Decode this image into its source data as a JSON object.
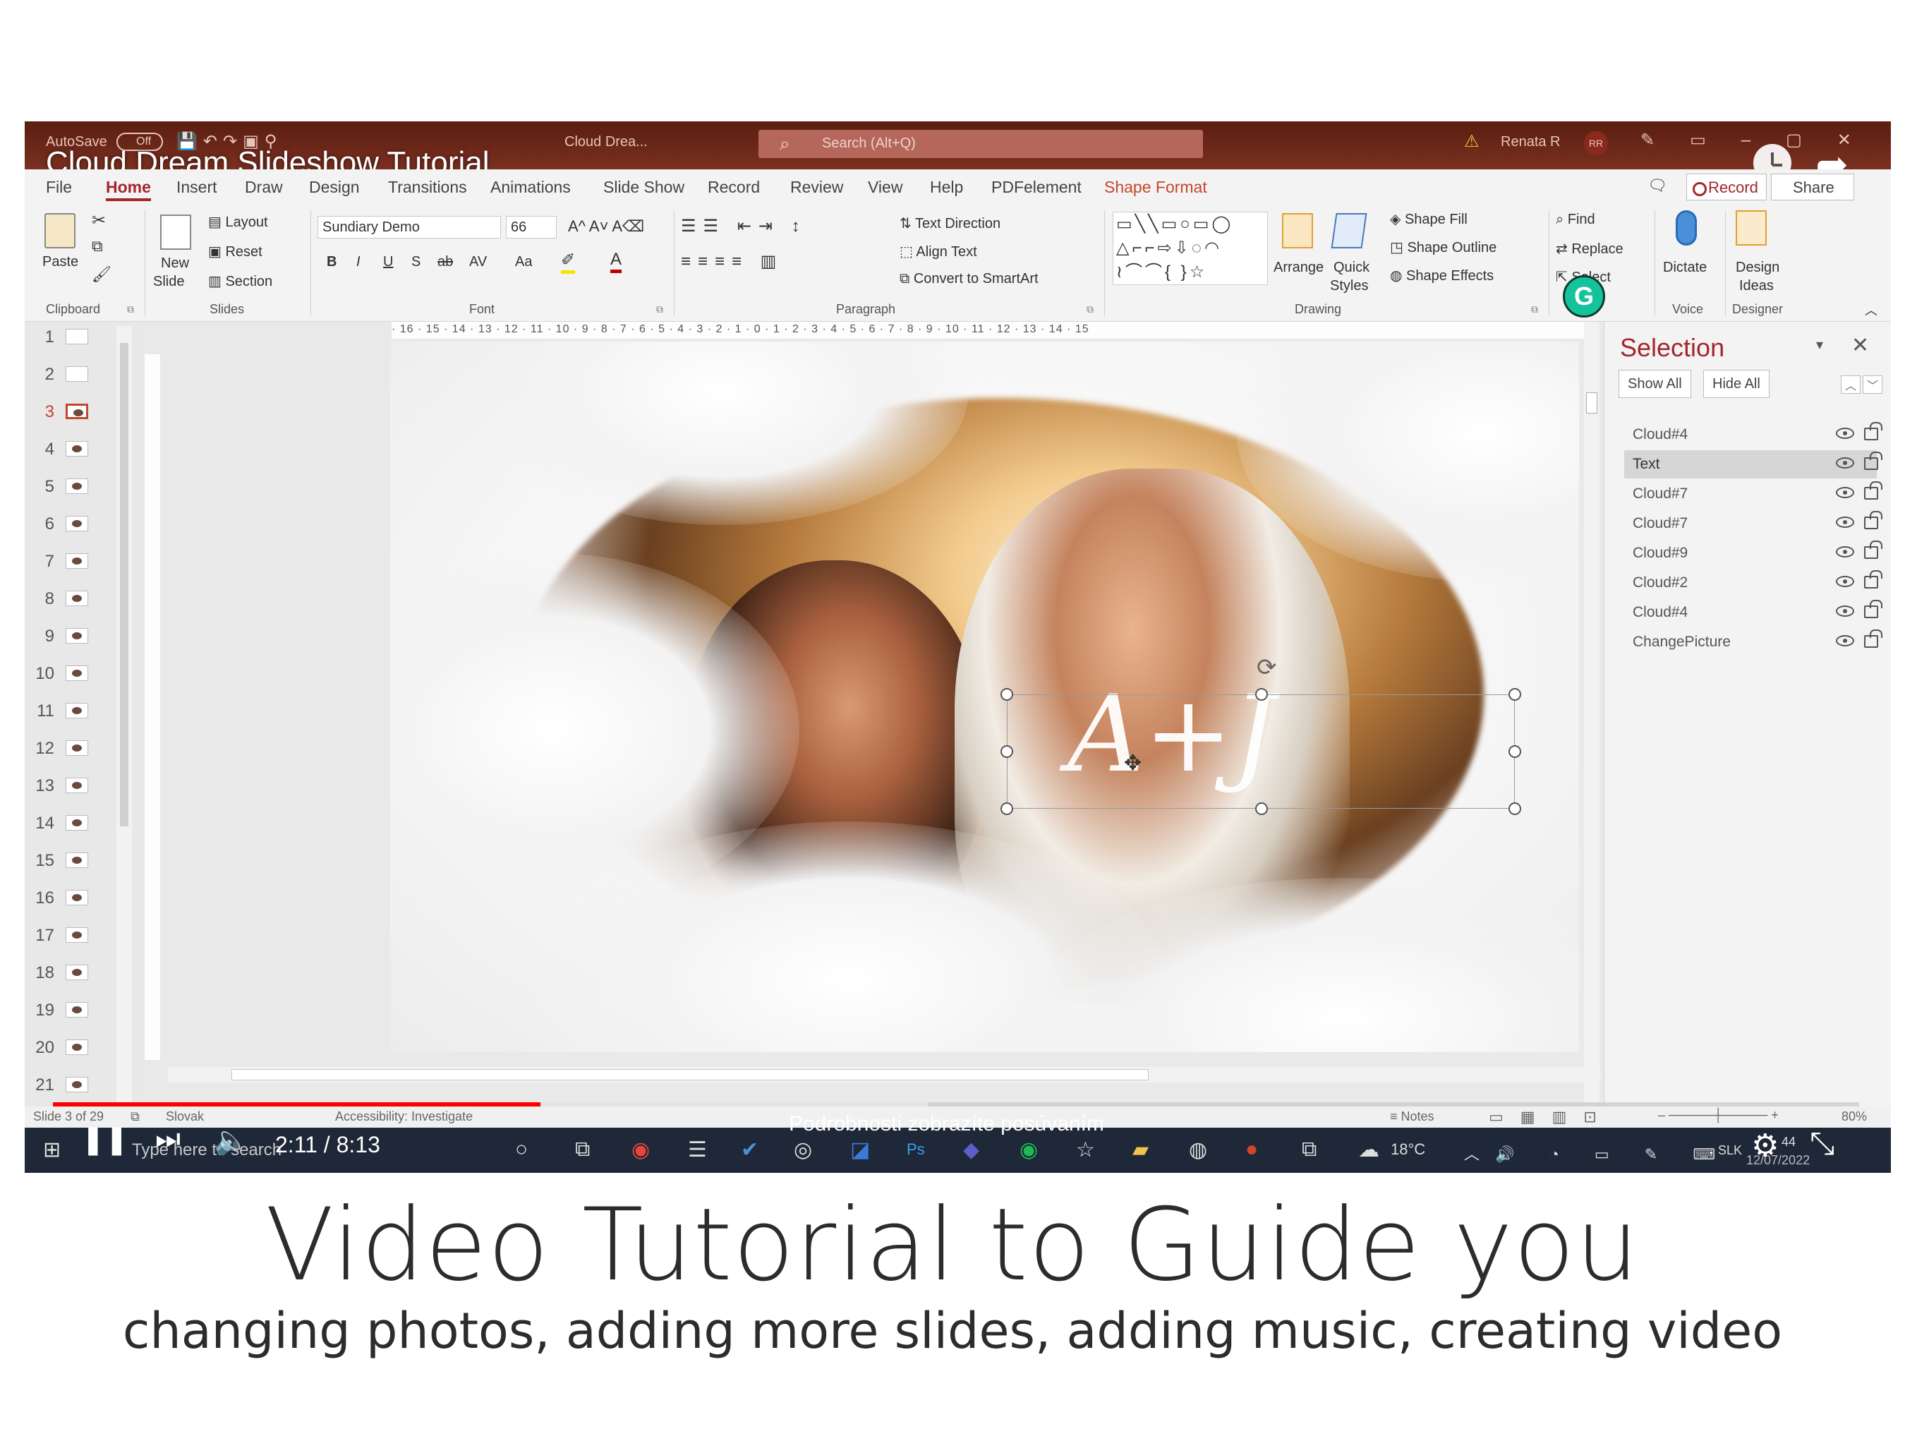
{
  "video": {
    "title": "Cloud Dream Slideshow Tutorial",
    "current_time": "2:11",
    "duration": "8:13",
    "time_display": "2:11 / 8:13",
    "progress_fraction": 0.27,
    "scroll_hint": "Podrobnosti zobrazíte posúvaním"
  },
  "titlebar": {
    "autosave": "AutoSave",
    "autosave_state": "Off",
    "document": "Cloud Drea...",
    "search_placeholder": "Search (Alt+Q)",
    "user": "Renata R",
    "user_initials": "RR"
  },
  "tabs": [
    "File",
    "Home",
    "Insert",
    "Draw",
    "Design",
    "Transitions",
    "Animations",
    "Slide Show",
    "Record",
    "Review",
    "View",
    "Help",
    "PDFelement",
    "Shape Format"
  ],
  "active_tab": "Home",
  "header_buttons": {
    "record": "Record",
    "share": "Share"
  },
  "ribbon": {
    "clipboard": {
      "paste": "Paste",
      "label": "Clipboard"
    },
    "slides": {
      "new_slide": "New",
      "new_slide2": "Slide",
      "layout": "Layout",
      "reset": "Reset",
      "section": "Section",
      "label": "Slides"
    },
    "font": {
      "name": "Sundiary Demo",
      "size": "66",
      "label": "Font",
      "buttons": [
        "B",
        "I",
        "U",
        "S",
        "ab",
        "AV",
        "Aa"
      ]
    },
    "paragraph": {
      "text_direction": "Text Direction",
      "align_text": "Align Text",
      "convert_smartart": "Convert to SmartArt",
      "label": "Paragraph"
    },
    "drawing": {
      "arrange": "Arrange",
      "quick": "Quick",
      "styles": "Styles",
      "shape_fill": "Shape Fill",
      "shape_outline": "Shape Outline",
      "shape_effects": "Shape Effects",
      "label": "Drawing"
    },
    "editing": {
      "find": "Find",
      "replace": "Replace",
      "select": "Select"
    },
    "voice": {
      "dictate": "Dictate",
      "label": "Voice"
    },
    "designer": {
      "design": "Design",
      "ideas": "Ideas",
      "label": "Designer"
    }
  },
  "slides": {
    "numbers": [
      "1",
      "2",
      "3",
      "4",
      "5",
      "6",
      "7",
      "8",
      "9",
      "10",
      "11",
      "12",
      "13",
      "14",
      "15",
      "16",
      "17",
      "18",
      "19",
      "20",
      "21"
    ],
    "active": "3"
  },
  "ruler_top": "· 16 · 15 · 14 · 13 · 12 · 11 · 10 · 9 · 8 · 7 · 6 · 5 · 4 · 3 · 2 · 1 · 0 · 1 · 2 · 3 · 4 · 5 · 6 · 7 · 8 · 9 · 10 · 11 · 12 · 13 · 14 · 15",
  "slide_text": "A+J",
  "selection_pane": {
    "title": "Selection",
    "show_all": "Show All",
    "hide_all": "Hide All",
    "items": [
      "Cloud#4",
      "Text",
      "Cloud#7",
      "Cloud#7",
      "Cloud#9",
      "Cloud#2",
      "Cloud#4",
      "ChangePicture"
    ],
    "selected": "Text"
  },
  "status": {
    "slide": "Slide 3 of 29",
    "language": "Slovak",
    "accessibility": "Accessibility: Investigate",
    "notes": "Notes",
    "zoom": "80%"
  },
  "taskbar": {
    "search": "Type here to search",
    "temperature": "18°C",
    "lang": "SLK",
    "time": "44",
    "date": "12/07/2022"
  },
  "captions": {
    "main": "Video Tutorial to Guide you",
    "sub": "changing photos, adding more slides, adding music, creating video"
  }
}
